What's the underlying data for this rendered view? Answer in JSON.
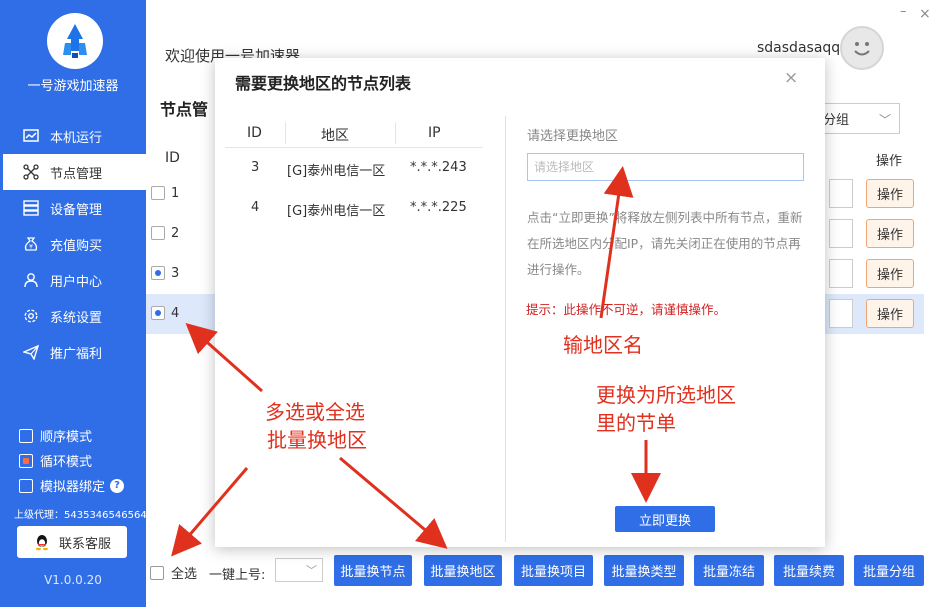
{
  "sidebar": {
    "app_name": "一号游戏加速器",
    "nav": [
      {
        "label": "本机运行",
        "icon": "chart-icon",
        "active": false
      },
      {
        "label": "节点管理",
        "icon": "nodes-icon",
        "active": true
      },
      {
        "label": "设备管理",
        "icon": "server-icon",
        "active": false
      },
      {
        "label": "充值购买",
        "icon": "yen-bag-icon",
        "active": false
      },
      {
        "label": "用户中心",
        "icon": "user-icon",
        "active": false
      },
      {
        "label": "系统设置",
        "icon": "gear-icon",
        "active": false
      },
      {
        "label": "推广福利",
        "icon": "send-icon",
        "active": false
      }
    ],
    "modes": [
      {
        "label": "顺序模式",
        "checked": false
      },
      {
        "label": "循环模式",
        "checked": true
      },
      {
        "label": "模拟器绑定",
        "checked": false
      }
    ],
    "agent": "上级代理：5435346546564",
    "service_button": "联系客服",
    "version": "V1.0.0.20"
  },
  "header": {
    "welcome": "欢迎使用一号加速器",
    "username": "sdasdasaqq",
    "minimize": "–",
    "close": "×"
  },
  "page": {
    "title": "节点管",
    "group_select": "分组",
    "col_id": "ID",
    "col_op": "操作",
    "rows": [
      {
        "id": "1",
        "op": "操作",
        "checked": false
      },
      {
        "id": "2",
        "op": "操作",
        "checked": false
      },
      {
        "id": "3",
        "op": "操作",
        "checked": true
      },
      {
        "id": "4",
        "op": "操作",
        "checked": true
      }
    ]
  },
  "bottom": {
    "select_all": "全选",
    "onekey": "一键上号:",
    "buttons": [
      "批量换节点",
      "批量换地区",
      "批量换项目",
      "批量换类型",
      "批量冻结",
      "批量续费",
      "批量分组"
    ]
  },
  "modal": {
    "title": "需要更换地区的节点列表",
    "close": "×",
    "cols": [
      "ID",
      "地区",
      "IP"
    ],
    "rows": [
      {
        "id": "3",
        "region": "[G]泰州电信一区",
        "ip": "*.*.*.243"
      },
      {
        "id": "4",
        "region": "[G]泰州电信一区",
        "ip": "*.*.*.225"
      }
    ],
    "right_label": "请选择更换地区",
    "input_placeholder": "请选择地区",
    "description": "点击“立即更换”将释放左侧列表中所有节点，重新在所选地区内分配IP，请先关闭正在使用的节点再进行操作。",
    "warning": "提示：此操作不可逆，请谨慎操作。",
    "apply_button": "立即更换"
  },
  "annotations": {
    "input_hint": "输地区名",
    "replace_hint_1": "更换为所选地区",
    "replace_hint_2": "里的节单",
    "multi_hint_1": "多选或全选",
    "multi_hint_2": "批量换地区",
    "color": "#e0301e"
  },
  "colors": {
    "sidebar": "#2f6ee6",
    "accent": "#2f6ee6",
    "warning": "#d21f1f",
    "op_button_border": "#f0a674"
  }
}
